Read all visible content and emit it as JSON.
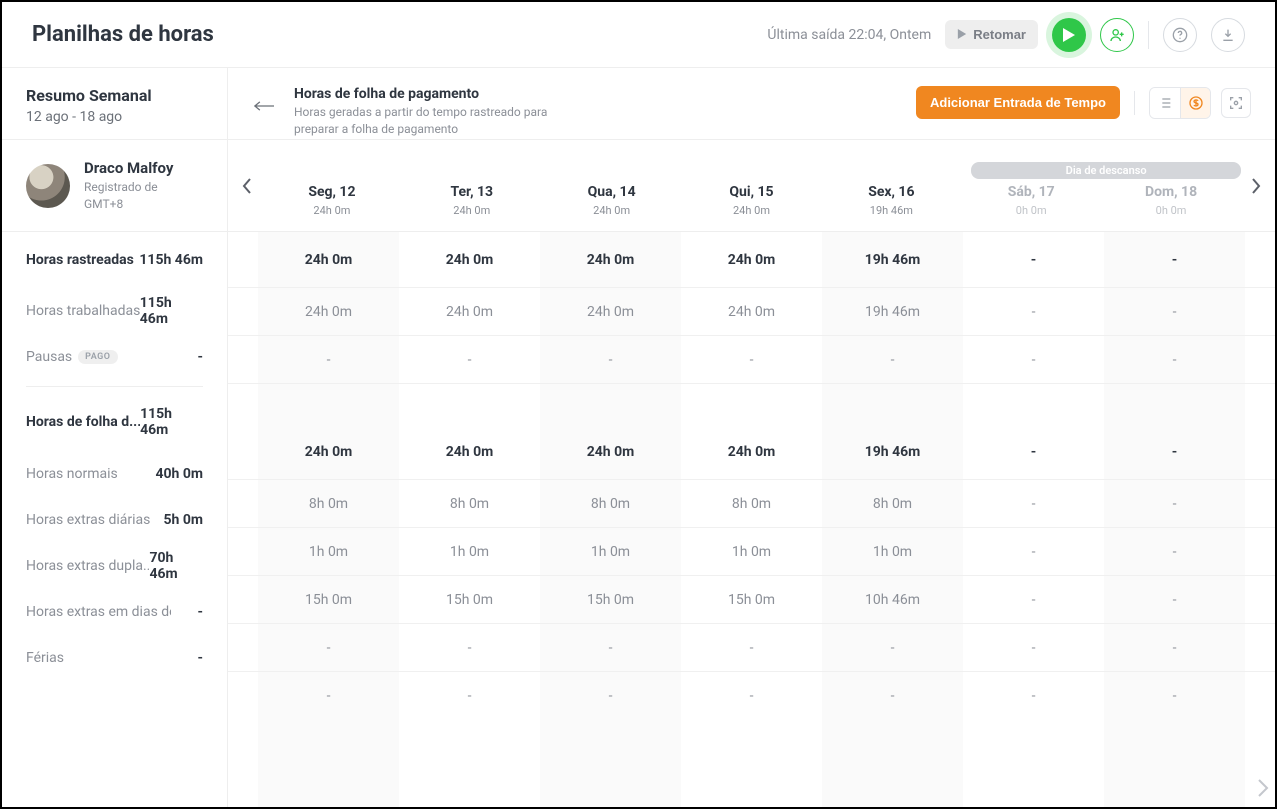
{
  "header": {
    "title": "Planilhas de horas",
    "last_stop": "Última saída 22:04, Ontem",
    "resume_label": "Retomar"
  },
  "sidebar": {
    "summary_title": "Resumo Semanal",
    "date_range": "12 ago - 18 ago",
    "user": {
      "name": "Draco Malfoy",
      "registered_label": "Registrado de",
      "timezone": "GMT+8"
    },
    "section1_title": "Horas rastreadas",
    "breaks_badge": "PAGO",
    "rows": [
      {
        "label": "Horas rastreadas",
        "value": "115h 46m",
        "head": true
      },
      {
        "label": "Horas trabalhadas",
        "value": "115h 46m"
      },
      {
        "label": "Pausas",
        "value": "-",
        "badge": true
      }
    ],
    "rows2": [
      {
        "label": "Horas de folha d...",
        "value": "115h 46m",
        "head": true
      },
      {
        "label": "Horas normais",
        "value": "40h 0m"
      },
      {
        "label": "Horas extras diárias",
        "value": "5h 0m"
      },
      {
        "label": "Horas extras dupla...",
        "value": "70h 46m"
      },
      {
        "label": "Horas extras em dias de de...",
        "value": "-"
      },
      {
        "label": "Férias",
        "value": "-"
      }
    ]
  },
  "main": {
    "payroll_title": "Horas de folha de pagamento",
    "payroll_subtitle": "Horas geradas a partir do tempo rastreado para preparar a folha de pagamento",
    "add_button": "Adicionar Entrada de Tempo",
    "rest_label": "Dia de descanso"
  },
  "days": [
    {
      "label": "Seg, 12",
      "total": "24h 0m",
      "dim": false,
      "rest": false
    },
    {
      "label": "Ter, 13",
      "total": "24h 0m",
      "dim": false,
      "rest": false
    },
    {
      "label": "Qua, 14",
      "total": "24h 0m",
      "dim": false,
      "rest": false
    },
    {
      "label": "Qui, 15",
      "total": "24h 0m",
      "dim": false,
      "rest": false
    },
    {
      "label": "Sex, 16",
      "total": "19h 46m",
      "dim": false,
      "rest": false,
      "today": true
    },
    {
      "label": "Sáb, 17",
      "total": "0h 0m",
      "dim": true,
      "rest": true
    },
    {
      "label": "Dom, 18",
      "total": "0h 0m",
      "dim": true,
      "rest": true
    }
  ],
  "grid": [
    {
      "strong": true,
      "cells": [
        "24h 0m",
        "24h 0m",
        "24h 0m",
        "24h 0m",
        "19h 46m",
        "-",
        "-"
      ]
    },
    {
      "cells": [
        "24h 0m",
        "24h 0m",
        "24h 0m",
        "24h 0m",
        "19h 46m",
        "-",
        "-"
      ]
    },
    {
      "gap": true,
      "cells": [
        "-",
        "-",
        "-",
        "-",
        "-",
        "-",
        "-"
      ]
    },
    {
      "strong": true,
      "cells": [
        "24h 0m",
        "24h 0m",
        "24h 0m",
        "24h 0m",
        "19h 46m",
        "-",
        "-"
      ]
    },
    {
      "cells": [
        "8h 0m",
        "8h 0m",
        "8h 0m",
        "8h 0m",
        "8h 0m",
        "-",
        "-"
      ]
    },
    {
      "cells": [
        "1h 0m",
        "1h 0m",
        "1h 0m",
        "1h 0m",
        "1h 0m",
        "-",
        "-"
      ]
    },
    {
      "cells": [
        "15h 0m",
        "15h 0m",
        "15h 0m",
        "15h 0m",
        "10h 46m",
        "-",
        "-"
      ]
    },
    {
      "cells": [
        "-",
        "-",
        "-",
        "-",
        "-",
        "-",
        "-"
      ]
    },
    {
      "noborder": true,
      "cells": [
        "-",
        "-",
        "-",
        "-",
        "-",
        "-",
        "-"
      ]
    }
  ]
}
